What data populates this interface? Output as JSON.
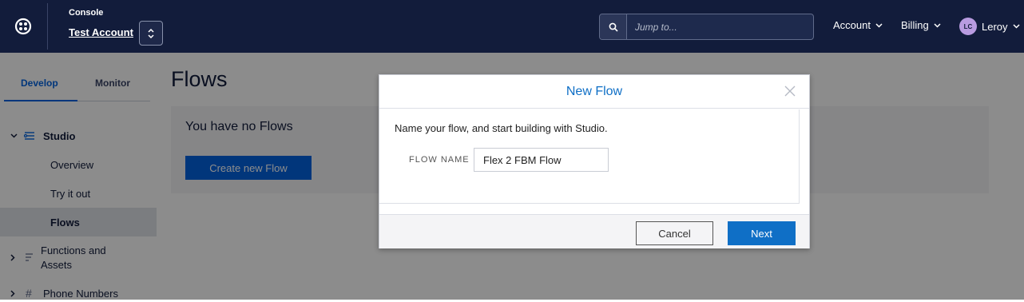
{
  "topbar": {
    "console_label": "Console",
    "account_name": "Test Account",
    "search_placeholder": "Jump to...",
    "menu_account": "Account",
    "menu_billing": "Billing",
    "user_initials": "LC",
    "user_name": "Leroy"
  },
  "sidebar": {
    "tabs": [
      "Develop",
      "Monitor"
    ],
    "items": {
      "studio": "Studio",
      "overview": "Overview",
      "try_it_out": "Try it out",
      "flows": "Flows",
      "functions_line1": "Functions and",
      "functions_line2": "Assets",
      "phone_numbers": "Phone Numbers"
    }
  },
  "main": {
    "title": "Flows",
    "empty_text": "You have no Flows",
    "create_button": "Create new Flow"
  },
  "modal": {
    "title": "New Flow",
    "description": "Name your flow, and start building with Studio.",
    "field_label": "FLOW NAME",
    "field_value": "Flex 2 FBM Flow",
    "cancel_label": "Cancel",
    "next_label": "Next"
  },
  "colors": {
    "topbar_bg": "#121c3b",
    "accent_blue": "#0263e0",
    "modal_title_blue": "#0f6fc6"
  }
}
